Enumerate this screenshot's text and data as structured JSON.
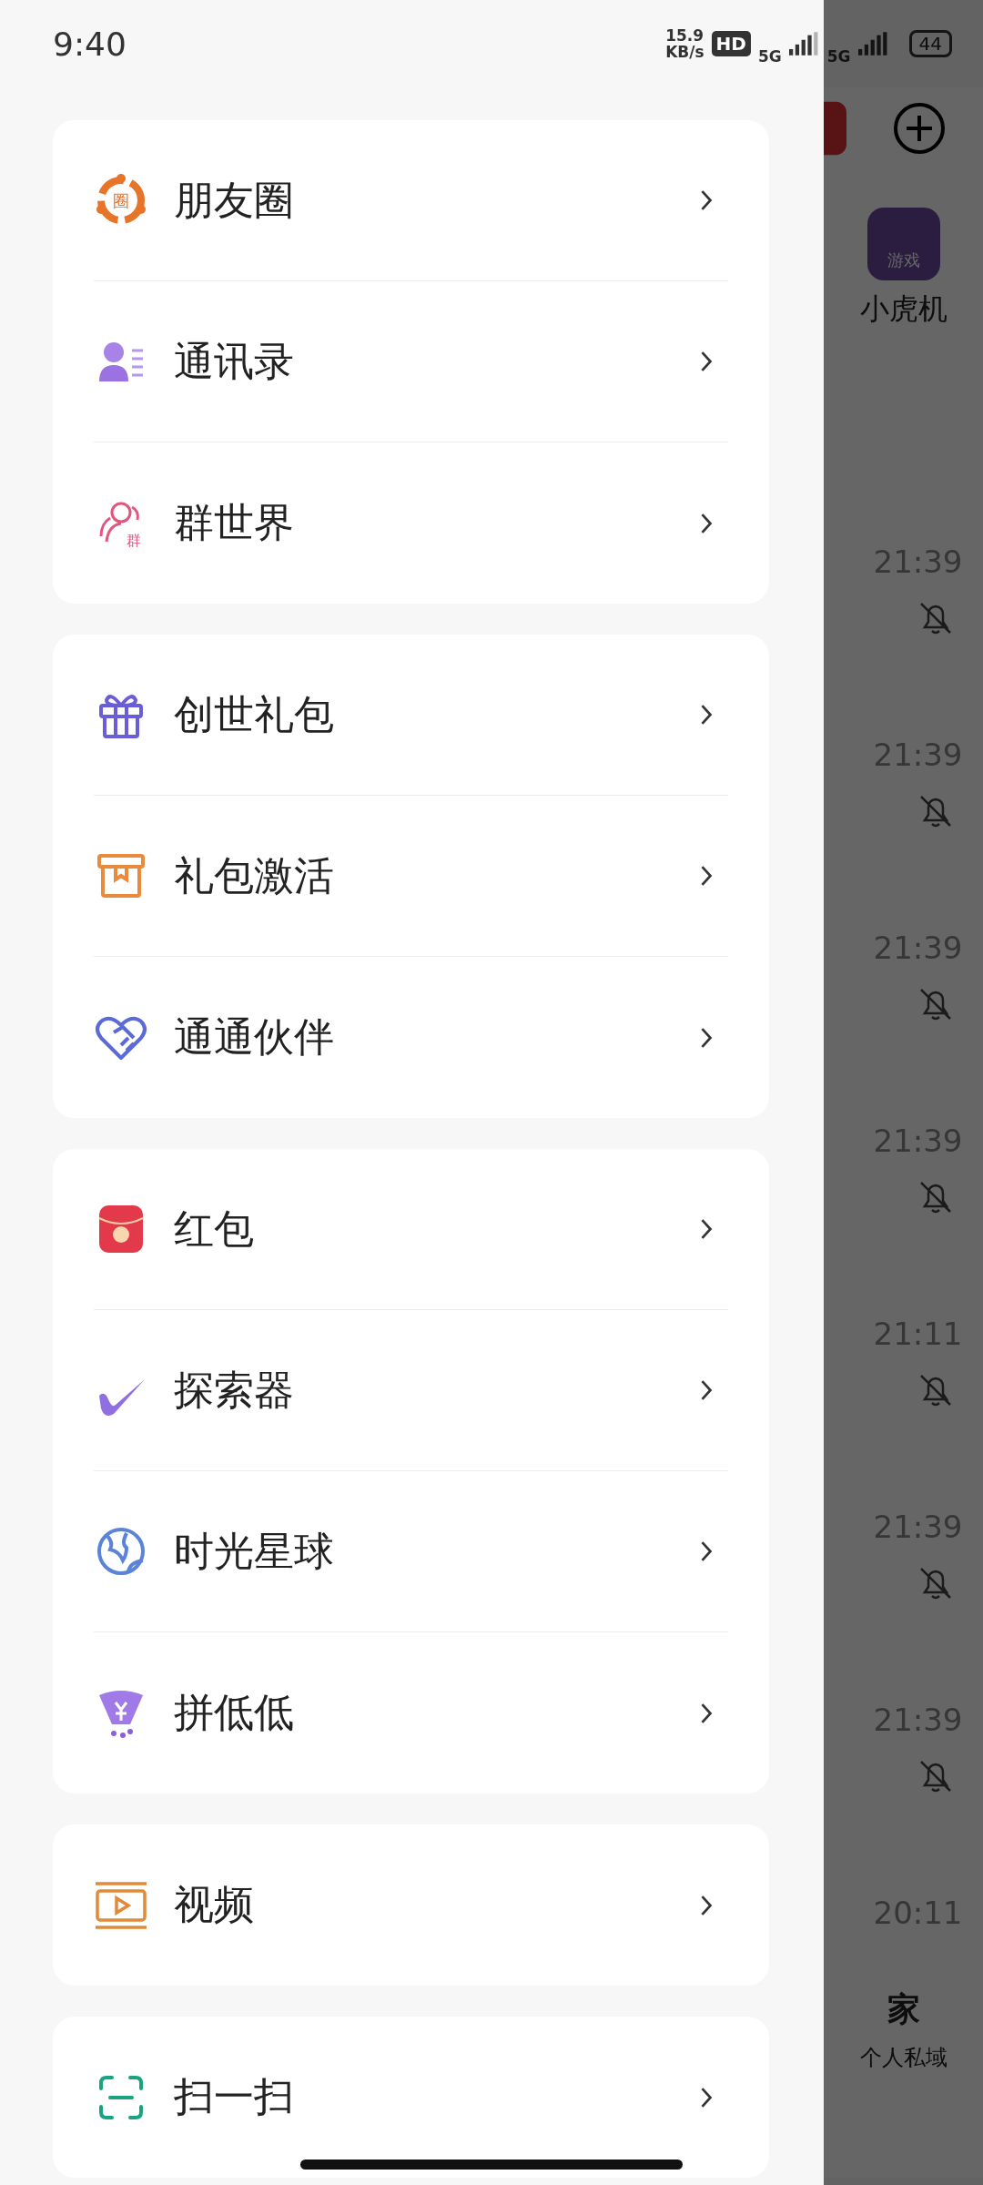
{
  "status_bar": {
    "time": "9:40",
    "speed": "15.9",
    "speed_unit": "KB/s",
    "hd": "HD",
    "sim1": "5G",
    "sim2": "5G",
    "battery": "44"
  },
  "menu_groups": [
    {
      "items": [
        {
          "label": "朋友圈",
          "kind": "moments",
          "icon_text": "圈"
        },
        {
          "label": "通讯录",
          "kind": "contacts"
        },
        {
          "label": "群世界",
          "kind": "group",
          "icon_text": "群"
        }
      ]
    },
    {
      "items": [
        {
          "label": "创世礼包",
          "kind": "gift"
        },
        {
          "label": "礼包激活",
          "kind": "box"
        },
        {
          "label": "通通伙伴",
          "kind": "handshake"
        }
      ]
    },
    {
      "items": [
        {
          "label": "红包",
          "kind": "envelope"
        },
        {
          "label": "探索器",
          "kind": "swoosh"
        },
        {
          "label": "时光星球",
          "kind": "globe"
        },
        {
          "label": "拼低低",
          "kind": "tornado"
        }
      ]
    },
    {
      "items": [
        {
          "label": "视频",
          "kind": "video"
        }
      ]
    },
    {
      "items": [
        {
          "label": "扫一扫",
          "kind": "scan"
        }
      ]
    }
  ],
  "background_chat": {
    "app_shortcut": {
      "icon_text": "游戏",
      "label": "小虎机"
    },
    "rows": [
      {
        "time": "21:39",
        "muted": true
      },
      {
        "time": "21:39",
        "muted": true
      },
      {
        "time": "21:39",
        "muted": true
      },
      {
        "time": "21:39",
        "muted": true
      },
      {
        "time": "21:11",
        "muted": true
      },
      {
        "time": "21:39",
        "muted": true
      },
      {
        "time": "21:39",
        "muted": true
      },
      {
        "time": "20:11",
        "muted": false
      }
    ],
    "bottom_tab": {
      "title": "家",
      "subtitle": "个人私域"
    }
  }
}
